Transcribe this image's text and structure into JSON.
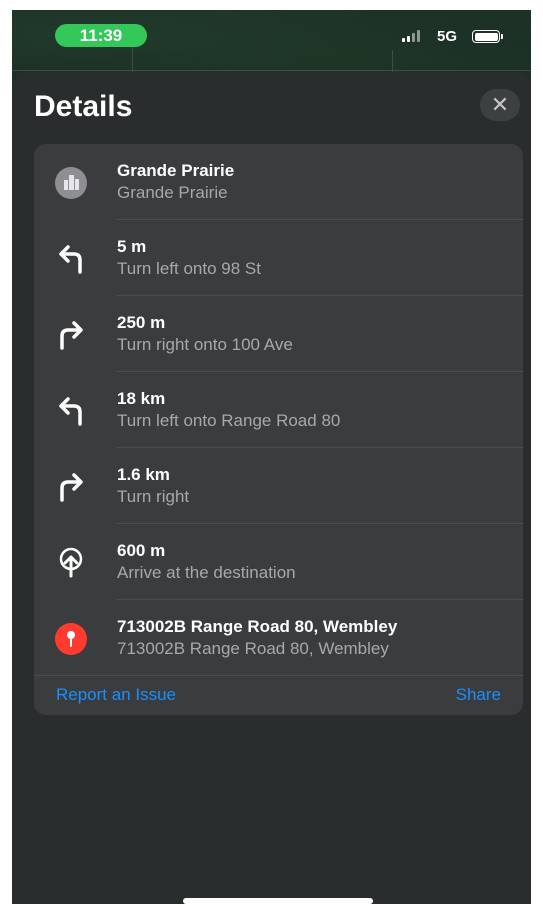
{
  "status_bar": {
    "time": "11:39",
    "network": "5G",
    "accent_color": "#34c759"
  },
  "map": {
    "label": "..."
  },
  "header": {
    "title": "Details",
    "close_icon": "close-icon"
  },
  "steps": [
    {
      "icon": "city-icon",
      "primary": "Grande Prairie",
      "secondary": "Grande Prairie"
    },
    {
      "icon": "turn-left-icon",
      "primary": "5 m",
      "secondary": "Turn left onto 98 St"
    },
    {
      "icon": "turn-right-icon",
      "primary": "250 m",
      "secondary": "Turn right onto 100 Ave"
    },
    {
      "icon": "turn-left-icon",
      "primary": "18 km",
      "secondary": "Turn left onto Range Road 80"
    },
    {
      "icon": "turn-right-icon",
      "primary": "1.6 km",
      "secondary": "Turn right"
    },
    {
      "icon": "arrive-icon",
      "primary": "600 m",
      "secondary": "Arrive at the destination"
    },
    {
      "icon": "pin-icon",
      "primary": "713002B Range Road 80, Wembley",
      "secondary": "713002B Range Road 80, Wembley"
    }
  ],
  "footer": {
    "report_label": "Report an Issue",
    "share_label": "Share",
    "link_color": "#1a8fff"
  },
  "pin_color": "#ff3b30"
}
